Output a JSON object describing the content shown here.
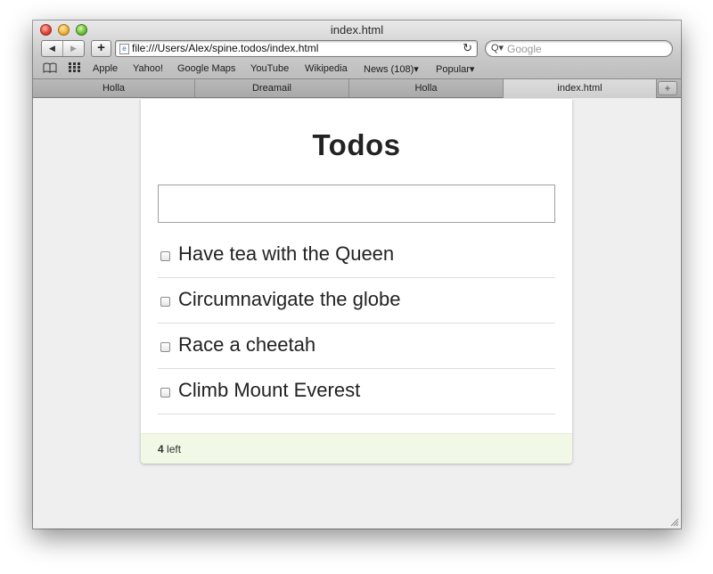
{
  "window": {
    "title": "index.html"
  },
  "toolbar": {
    "back_glyph": "◀",
    "forward_glyph": "▶",
    "add_glyph": "+",
    "url": "file:///Users/Alex/spine.todos/index.html",
    "reload_glyph": "↻",
    "search_placeholder": "Google",
    "search_glyph": "Q▾"
  },
  "bookmarks": {
    "book_icon": "book-icon",
    "grid_icon": "grid-icon",
    "items": [
      "Apple",
      "Yahoo!",
      "Google Maps",
      "YouTube",
      "Wikipedia",
      "News (108)▾",
      "Popular▾"
    ]
  },
  "tabs": {
    "items": [
      "Holla",
      "Dreamail",
      "Holla",
      "index.html"
    ],
    "active": "index.html",
    "add_glyph": "+"
  },
  "app": {
    "title": "Todos",
    "new_todo_value": "",
    "todos": [
      {
        "label": "Have tea with the Queen",
        "done": false
      },
      {
        "label": "Circumnavigate the globe",
        "done": false
      },
      {
        "label": "Race a cheetah",
        "done": false
      },
      {
        "label": "Climb Mount Everest",
        "done": false
      }
    ],
    "footer": {
      "count": "4",
      "suffix": " left"
    }
  }
}
